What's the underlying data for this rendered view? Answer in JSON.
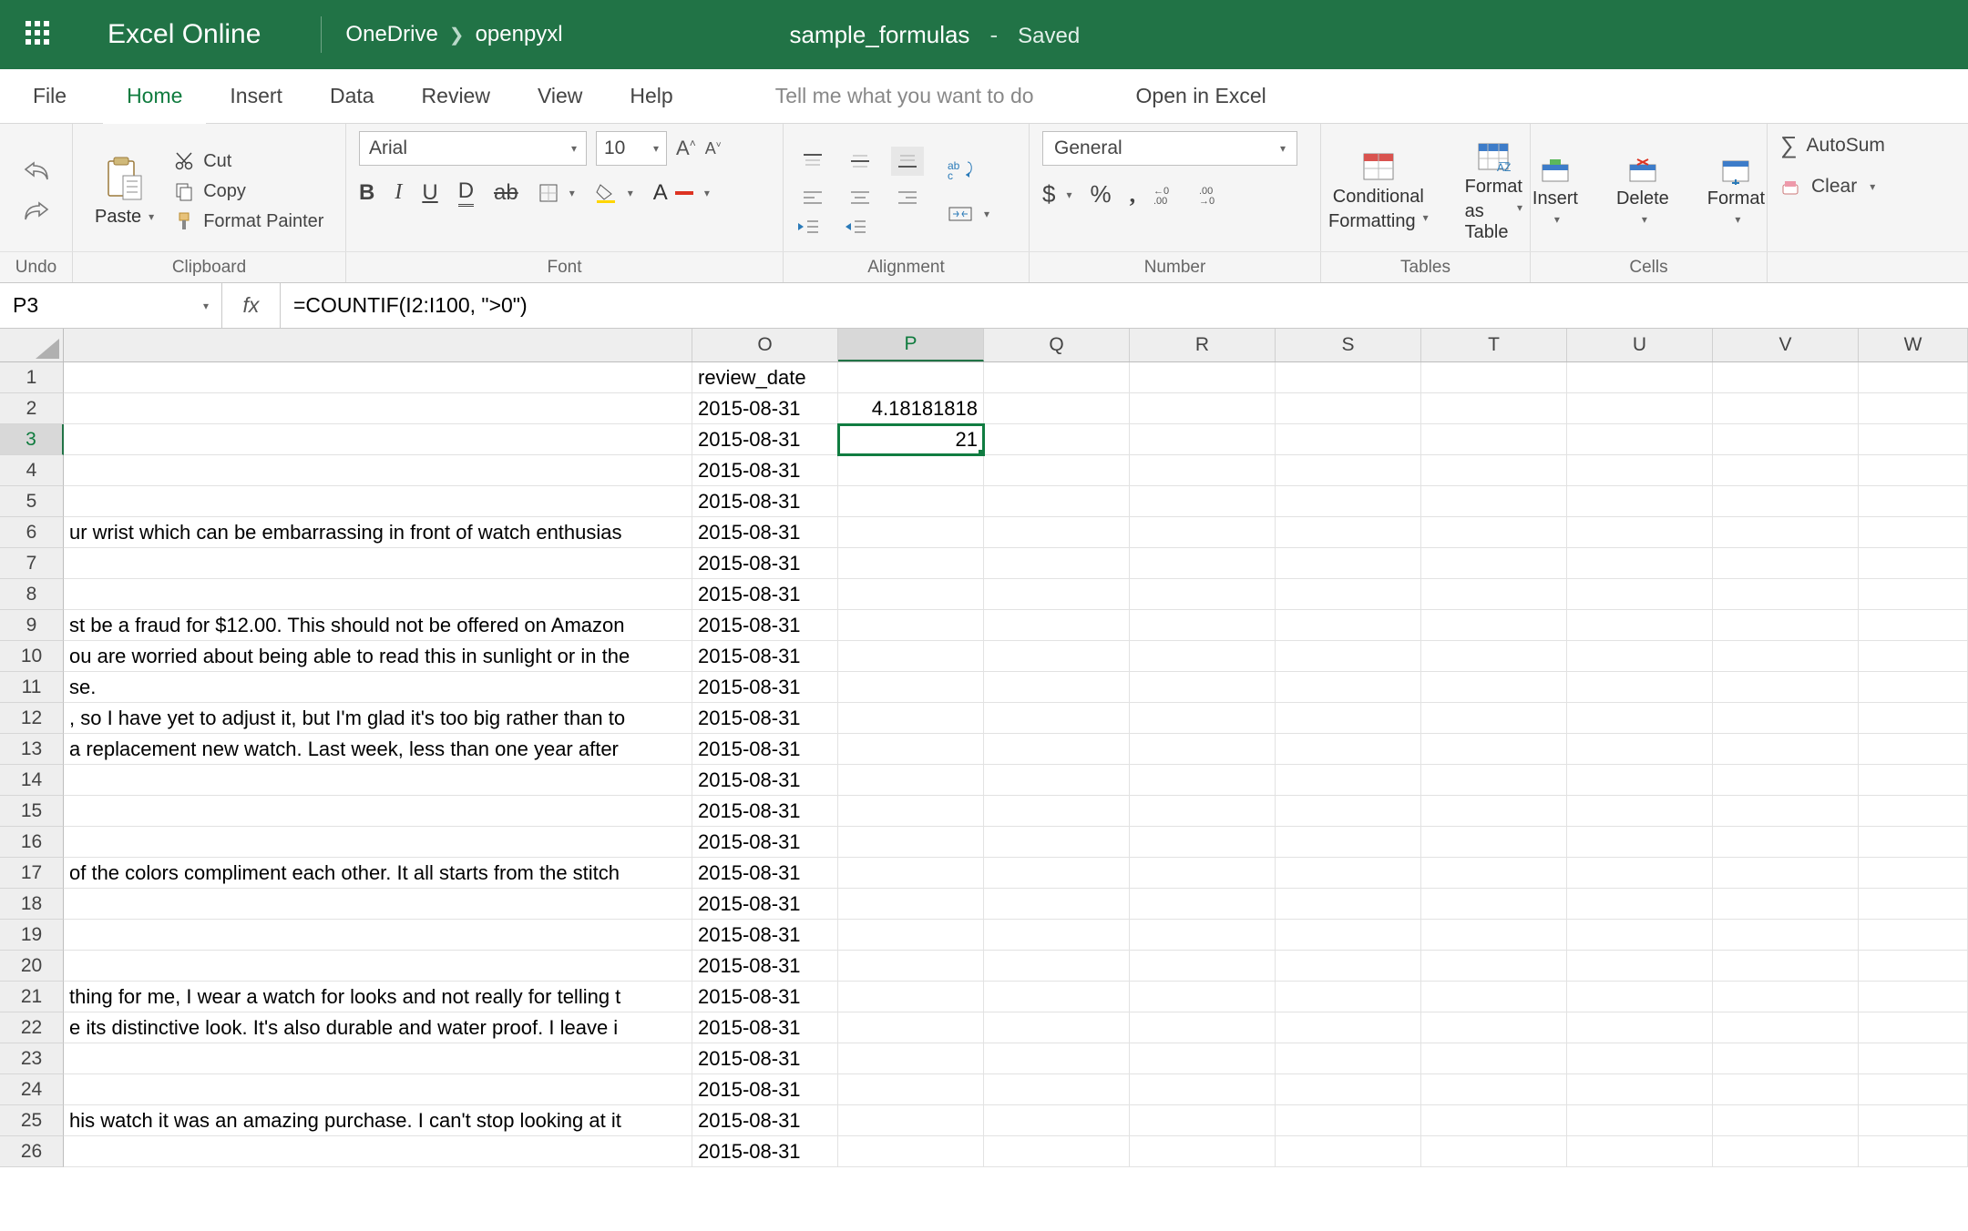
{
  "titlebar": {
    "app_name": "Excel Online",
    "crumb_root": "OneDrive",
    "crumb_folder": "openpyxl",
    "doc_name": "sample_formulas",
    "doc_status": "Saved"
  },
  "menu": {
    "file": "File",
    "home": "Home",
    "insert": "Insert",
    "data": "Data",
    "review": "Review",
    "view": "View",
    "help": "Help",
    "tell_me": "Tell me what you want to do",
    "open_in_excel": "Open in Excel"
  },
  "ribbon": {
    "undo_group": "Undo",
    "clipboard_group": "Clipboard",
    "font_group": "Font",
    "alignment_group": "Alignment",
    "number_group": "Number",
    "tables_group": "Tables",
    "cells_group": "Cells",
    "paste": "Paste",
    "cut": "Cut",
    "copy": "Copy",
    "format_painter": "Format Painter",
    "font_name": "Arial",
    "font_size": "10",
    "number_format": "General",
    "conditional_formatting_1": "Conditional",
    "conditional_formatting_2": "Formatting",
    "format_as_table_1": "Format",
    "format_as_table_2": "as Table",
    "insert_cells": "Insert",
    "delete_cells": "Delete",
    "format_cells": "Format",
    "autosum": "AutoSum",
    "clear": "Clear"
  },
  "formula_bar": {
    "cell_ref": "P3",
    "fx_label": "fx",
    "formula": "=COUNTIF(I2:I100, \">0\")"
  },
  "columns": [
    "O",
    "P",
    "Q",
    "R",
    "S",
    "T",
    "U",
    "V",
    "W"
  ],
  "active_col": "P",
  "active_row": 3,
  "rows": [
    {
      "n": 1,
      "trunc": "",
      "o": "review_date",
      "p": ""
    },
    {
      "n": 2,
      "trunc": "",
      "o": "2015-08-31",
      "p": "4.18181818"
    },
    {
      "n": 3,
      "trunc": "",
      "o": "2015-08-31",
      "p": "21"
    },
    {
      "n": 4,
      "trunc": "",
      "o": "2015-08-31",
      "p": ""
    },
    {
      "n": 5,
      "trunc": "",
      "o": "2015-08-31",
      "p": ""
    },
    {
      "n": 6,
      "trunc": "ur wrist which can be embarrassing in front of watch enthusias",
      "o": "2015-08-31",
      "p": ""
    },
    {
      "n": 7,
      "trunc": "",
      "o": "2015-08-31",
      "p": ""
    },
    {
      "n": 8,
      "trunc": "",
      "o": "2015-08-31",
      "p": ""
    },
    {
      "n": 9,
      "trunc": "st be a fraud for $12.00. This should not be offered on Amazon",
      "o": "2015-08-31",
      "p": ""
    },
    {
      "n": 10,
      "trunc": "ou are worried about being able to read this in sunlight or in the",
      "o": "2015-08-31",
      "p": ""
    },
    {
      "n": 11,
      "trunc": "se.",
      "o": "2015-08-31",
      "p": ""
    },
    {
      "n": 12,
      "trunc": ", so I have yet to adjust it, but I'm glad it's too big rather than to",
      "o": "2015-08-31",
      "p": ""
    },
    {
      "n": 13,
      "trunc": "a replacement new watch. Last week, less than one year after",
      "o": "2015-08-31",
      "p": ""
    },
    {
      "n": 14,
      "trunc": "",
      "o": "2015-08-31",
      "p": ""
    },
    {
      "n": 15,
      "trunc": "",
      "o": "2015-08-31",
      "p": ""
    },
    {
      "n": 16,
      "trunc": "",
      "o": "2015-08-31",
      "p": ""
    },
    {
      "n": 17,
      "trunc": "of the colors compliment each other. It all starts from the stitch",
      "o": "2015-08-31",
      "p": ""
    },
    {
      "n": 18,
      "trunc": "",
      "o": "2015-08-31",
      "p": ""
    },
    {
      "n": 19,
      "trunc": "",
      "o": "2015-08-31",
      "p": ""
    },
    {
      "n": 20,
      "trunc": "",
      "o": "2015-08-31",
      "p": ""
    },
    {
      "n": 21,
      "trunc": "thing for me, I wear a watch for looks and not really for telling t",
      "o": "2015-08-31",
      "p": ""
    },
    {
      "n": 22,
      "trunc": "e its distinctive look. It's also durable and water proof. I leave i",
      "o": "2015-08-31",
      "p": ""
    },
    {
      "n": 23,
      "trunc": "",
      "o": "2015-08-31",
      "p": ""
    },
    {
      "n": 24,
      "trunc": "",
      "o": "2015-08-31",
      "p": ""
    },
    {
      "n": 25,
      "trunc": "his watch it was an amazing purchase. I can't stop looking at it",
      "o": "2015-08-31",
      "p": ""
    },
    {
      "n": 26,
      "trunc": "",
      "o": "2015-08-31",
      "p": ""
    }
  ]
}
